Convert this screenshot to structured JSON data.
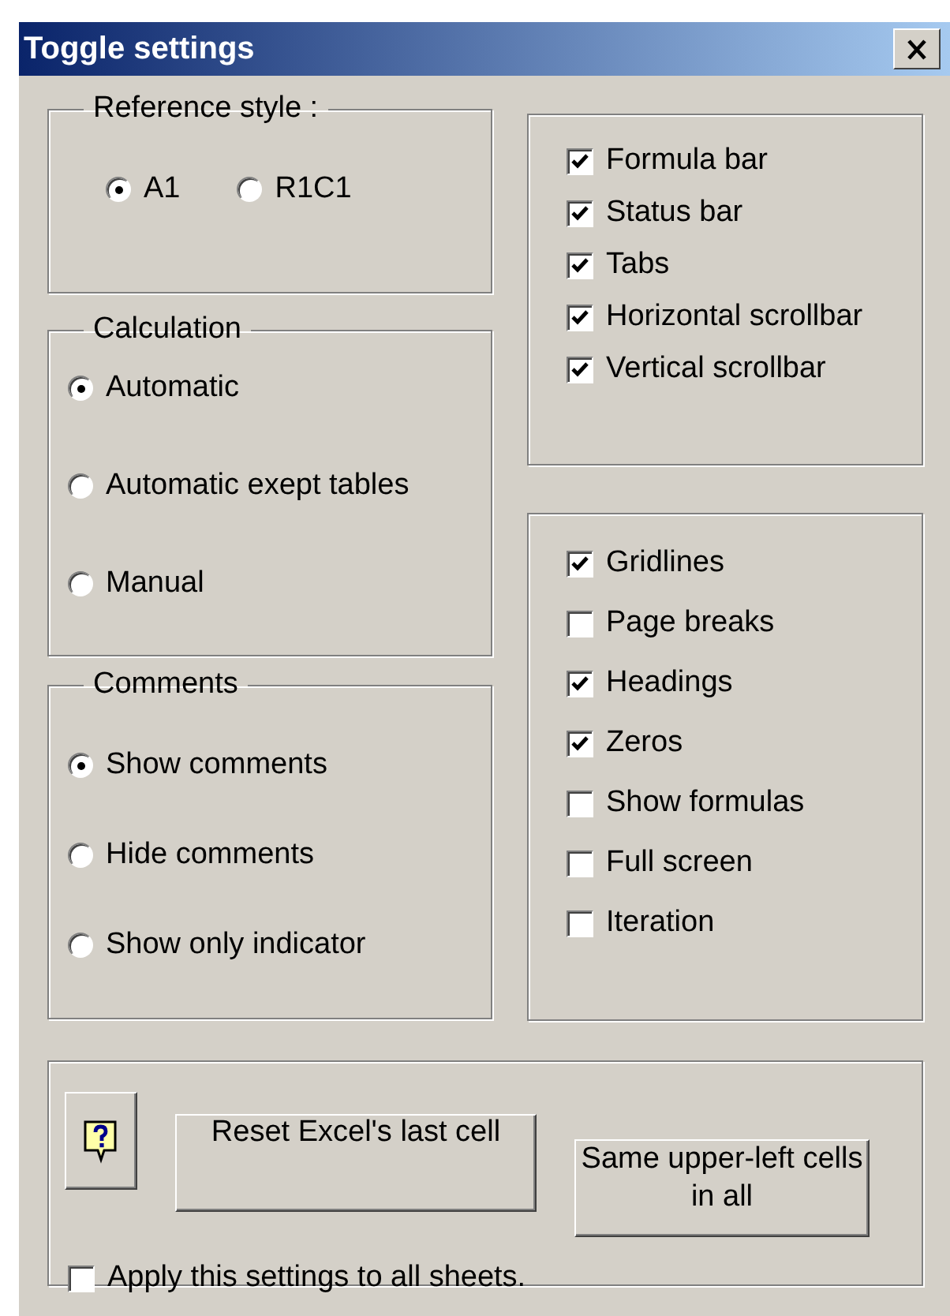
{
  "window": {
    "title": "Toggle settings"
  },
  "reference_style": {
    "label": "Reference style :",
    "options": [
      {
        "label": "A1",
        "selected": true
      },
      {
        "label": "R1C1",
        "selected": false
      }
    ]
  },
  "calculation": {
    "label": "Calculation",
    "options": [
      {
        "label": "Automatic",
        "selected": true
      },
      {
        "label": "Automatic exept tables",
        "selected": false
      },
      {
        "label": "Manual",
        "selected": false
      }
    ]
  },
  "comments": {
    "label": "Comments",
    "options": [
      {
        "label": "Show comments",
        "selected": true
      },
      {
        "label": "Hide comments",
        "selected": false
      },
      {
        "label": "Show only indicator",
        "selected": false
      }
    ]
  },
  "view_options": [
    {
      "label": "Formula bar",
      "checked": true
    },
    {
      "label": "Status bar",
      "checked": true
    },
    {
      "label": "Tabs",
      "checked": true
    },
    {
      "label": "Horizontal scrollbar",
      "checked": true
    },
    {
      "label": "Vertical scrollbar",
      "checked": true
    }
  ],
  "sheet_options": [
    {
      "label": "Gridlines",
      "checked": true
    },
    {
      "label": "Page breaks",
      "checked": false
    },
    {
      "label": "Headings",
      "checked": true
    },
    {
      "label": "Zeros",
      "checked": true
    },
    {
      "label": "Show formulas",
      "checked": false
    },
    {
      "label": "Full screen",
      "checked": false
    },
    {
      "label": "Iteration",
      "checked": false
    }
  ],
  "buttons": [
    {
      "kind": "help"
    },
    {
      "kind": "text",
      "label": "Reset Excel's last cell"
    },
    {
      "kind": "text",
      "label": "Same upper-left cells in all"
    }
  ],
  "apply_all": {
    "label": "Apply this settings to all sheets.",
    "checked": false
  }
}
